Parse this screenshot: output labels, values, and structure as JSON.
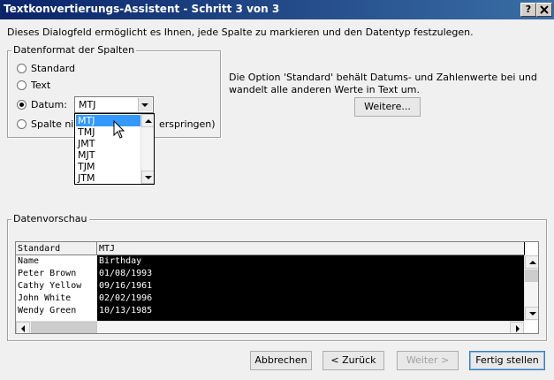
{
  "window": {
    "title": "Textkonvertierungs-Assistent - Schritt 3 von 3",
    "help_label": "?",
    "close_label": "X"
  },
  "description": "Dieses Dialogfeld ermöglicht es Ihnen, jede Spalte zu markieren und den Datentyp festzulegen.",
  "format_group": {
    "legend": "Datenformat der Spalten",
    "options": [
      {
        "label": "Standard",
        "checked": false
      },
      {
        "label": "Text",
        "checked": false
      },
      {
        "label": "Datum:",
        "checked": true
      },
      {
        "label_left": "Spalte nic",
        "label_right": "erspringen)",
        "checked": false
      }
    ],
    "date_combo": {
      "value": "MTJ",
      "options": [
        "MTJ",
        "TMJ",
        "JMT",
        "MJT",
        "TJM",
        "JTM"
      ],
      "selected_index": 0
    }
  },
  "info_text": "Die Option 'Standard' behält Datums- und Zahlenwerte bei und wandelt alle anderen Werte in Text um.",
  "advanced_button": "Weitere...",
  "preview": {
    "legend": "Datenvorschau",
    "headers": [
      "Standard",
      "MTJ"
    ],
    "rows": [
      [
        "Name",
        "Birthday"
      ],
      [
        "Peter Brown",
        "01/08/1993"
      ],
      [
        "Cathy Yellow",
        "09/16/1961"
      ],
      [
        "John White",
        "02/02/1996"
      ],
      [
        "Wendy Green",
        "10/13/1985"
      ]
    ]
  },
  "buttons": {
    "cancel": "Abbrechen",
    "back": "< Zurück",
    "next": "Weiter >",
    "finish": "Fertig stellen"
  },
  "colors": {
    "title_start": "#0a246a",
    "title_end": "#3a6ea5",
    "selection": "#3399ff",
    "preview_selected_col": "#000000"
  }
}
